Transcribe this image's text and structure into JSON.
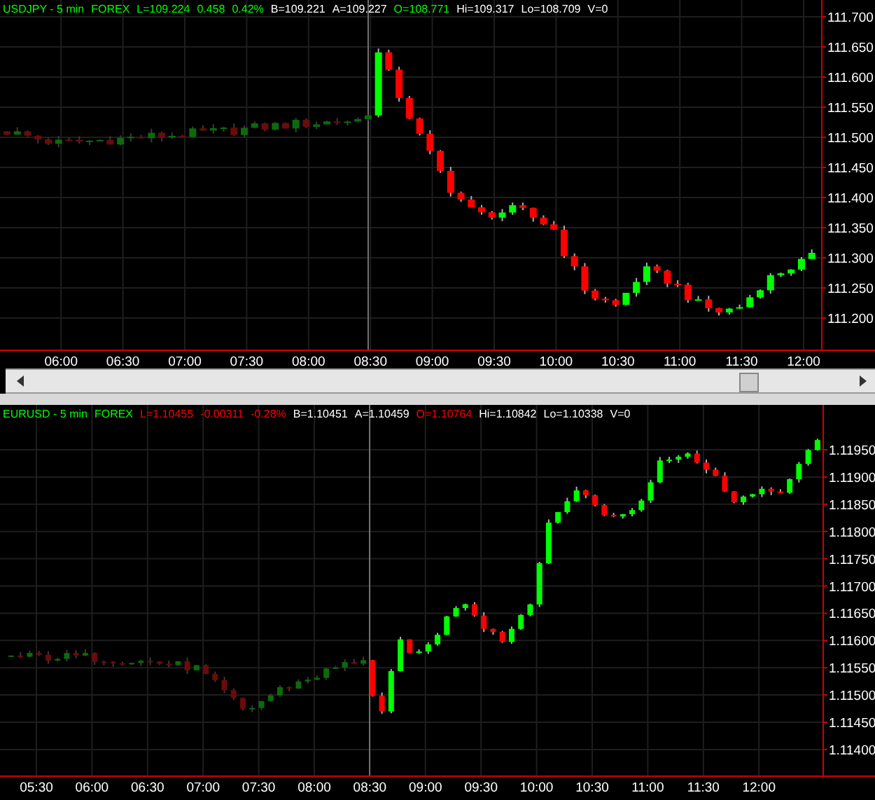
{
  "panels": [
    {
      "header": [
        {
          "text": "USDJPY - 5 min",
          "color": "#00ff00"
        },
        {
          "text": "FOREX",
          "color": "#00ff00"
        },
        {
          "text": "L=109.224",
          "color": "#00ff00"
        },
        {
          "text": "0.458",
          "color": "#00ff00"
        },
        {
          "text": "0.42%",
          "color": "#00ff00"
        },
        {
          "text": "B=109.221",
          "color": "#ffffff"
        },
        {
          "text": "A=109.227",
          "color": "#ffffff"
        },
        {
          "text": "O=108.771",
          "color": "#00ff00"
        },
        {
          "text": "Hi=109.317",
          "color": "#ffffff"
        },
        {
          "text": "Lo=108.709",
          "color": "#ffffff"
        },
        {
          "text": "V=0",
          "color": "#ffffff"
        }
      ],
      "price_labels": [
        "111.700",
        "111.650",
        "111.600",
        "111.550",
        "111.500",
        "111.450",
        "111.400",
        "111.350",
        "111.300",
        "111.250",
        "111.200"
      ],
      "time_labels": [
        "06:00",
        "06:30",
        "07:00",
        "07:30",
        "08:00",
        "08:30",
        "09:00",
        "09:30",
        "10:00",
        "10:30",
        "11:00",
        "11:30",
        "12:00"
      ]
    },
    {
      "header": [
        {
          "text": "EURUSD - 5 min",
          "color": "#00ff00"
        },
        {
          "text": "FOREX",
          "color": "#00ff00"
        },
        {
          "text": "L=1.10455",
          "color": "#ff0000"
        },
        {
          "text": "-0.00311",
          "color": "#ff0000"
        },
        {
          "text": "-0.28%",
          "color": "#ff0000"
        },
        {
          "text": "B=1.10451",
          "color": "#ffffff"
        },
        {
          "text": "A=1.10459",
          "color": "#ffffff"
        },
        {
          "text": "O=1.10764",
          "color": "#ff0000"
        },
        {
          "text": "Hi=1.10842",
          "color": "#ffffff"
        },
        {
          "text": "Lo=1.10338",
          "color": "#ffffff"
        },
        {
          "text": "V=0",
          "color": "#ffffff"
        }
      ],
      "price_labels": [
        "1.11950",
        "1.11900",
        "1.11850",
        "1.11800",
        "1.11750",
        "1.11700",
        "1.11650",
        "1.11600",
        "1.11550",
        "1.11500",
        "1.11450",
        "1.11400"
      ],
      "time_labels": [
        "05:30",
        "06:00",
        "06:30",
        "07:00",
        "07:30",
        "08:00",
        "08:30",
        "09:00",
        "09:30",
        "10:00",
        "10:30",
        "11:00",
        "11:30",
        "12:00"
      ]
    }
  ]
}
